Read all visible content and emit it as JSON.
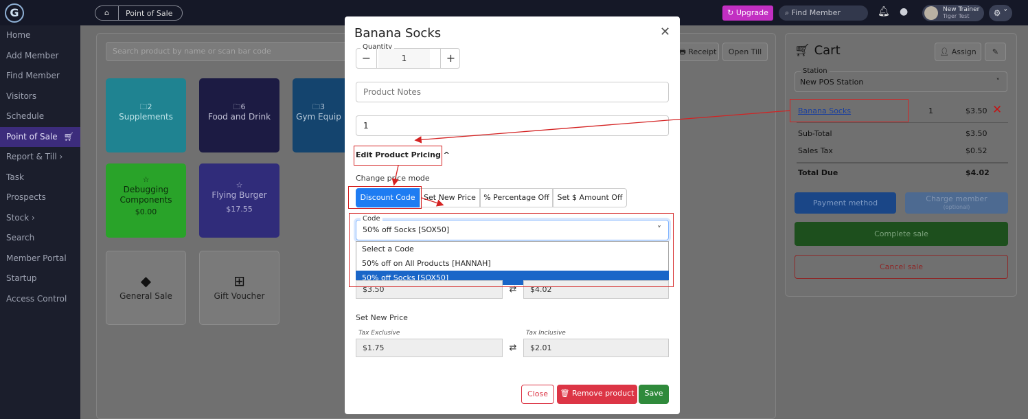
{
  "topbar": {
    "logo": "G",
    "breadcrumb_home_icon": "⌂",
    "breadcrumb": "Point of Sale",
    "upgrade": "Upgrade",
    "find_member": "Find Member",
    "user_name": "New Trainer",
    "user_sub": "Tiger Test",
    "gear_icon": "gear-icon"
  },
  "sidebar": {
    "items": [
      "Home",
      "Add Member",
      "Find Member",
      "Visitors",
      "Schedule",
      "Point of Sale",
      "Report & Till ›",
      "Task",
      "Prospects",
      "Stock ›",
      "Search",
      "Member Portal",
      "Startup",
      "Access Control"
    ]
  },
  "products": {
    "search_placeholder": "Search product by name or scan bar code",
    "receipt": "Receipt",
    "open_till": "Open Till",
    "tiles": [
      {
        "icon": "folder-icon",
        "count": "2",
        "label": "Supplements",
        "color": "#1f8391"
      },
      {
        "icon": "folder-icon",
        "count": "6",
        "label": "Food and Drink",
        "color": "#1c1b43"
      },
      {
        "icon": "folder-icon",
        "count": "3",
        "label": "Gym Equip",
        "color": "#14446e"
      },
      {
        "icon": "star-icon",
        "label": "Debugging Components",
        "price": "$0.00",
        "color": "#29a329"
      },
      {
        "icon": "star-icon",
        "label": "Flying Burger",
        "price": "$17.55",
        "color": "#302c7a"
      },
      {
        "icon": "tag-icon",
        "label": "General Sale"
      },
      {
        "icon": "gift-icon",
        "label": "Gift Voucher"
      }
    ]
  },
  "cart": {
    "title": "Cart",
    "assign": "Assign",
    "station_label": "Station",
    "station_value": "New POS Station",
    "item": {
      "name": "Banana Socks",
      "qty": "1",
      "price": "$3.50"
    },
    "subtotal_label": "Sub-Total",
    "subtotal": "$3.50",
    "tax_label": "Sales Tax",
    "tax": "$0.52",
    "total_label": "Total Due",
    "total": "$4.02",
    "payment_method": "Payment method",
    "charge_member": "Charge member",
    "charge_member_sub": "(optional)",
    "complete_sale": "Complete sale",
    "cancel_sale": "Cancel sale"
  },
  "modal": {
    "title": "Banana Socks",
    "quantity_label": "Quantity",
    "quantity": "1",
    "minus": "−",
    "plus": "+",
    "notes_placeholder": "Product Notes",
    "value_field": "1",
    "edit_pricing": "Edit Product Pricing ^",
    "change_mode": "Change price mode",
    "modes": [
      "Discount Code",
      "Set New Price",
      "% Percentage Off",
      "Set $ Amount Off"
    ],
    "code_label": "Code",
    "code_value": "50% off Socks [SOX50]",
    "code_options": [
      "Select a Code",
      "50% off on All Products [HANNAH]",
      "50% off Socks [SOX50]"
    ],
    "current_excl": "$3.50",
    "current_incl": "$4.02",
    "set_new_price": "Set New Price",
    "tax_exclusive": "Tax Exclusive",
    "tax_inclusive": "Tax Inclusive",
    "new_excl": "$1.75",
    "new_incl": "$2.01",
    "close": "Close",
    "remove": "Remove product",
    "save": "Save"
  }
}
